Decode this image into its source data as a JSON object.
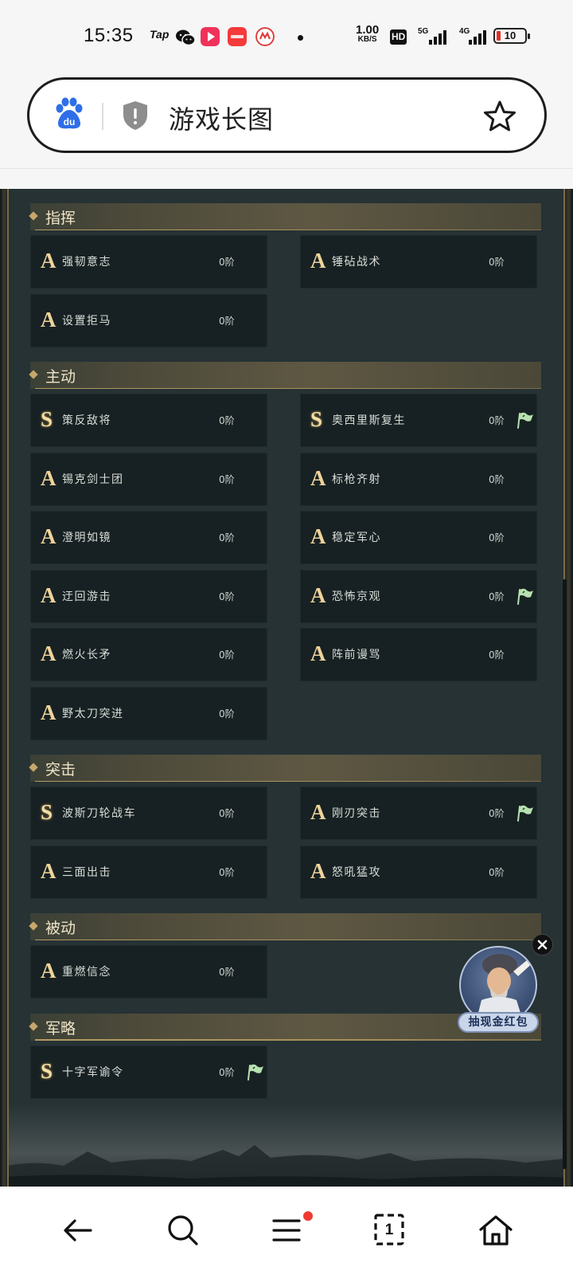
{
  "status_bar": {
    "time": "15:35",
    "tap_label": "Tap",
    "speed_value": "1.00",
    "speed_unit": "KB/S",
    "hd_label": "HD",
    "network_1": "5G",
    "network_2": "4G",
    "battery": "10",
    "battery_color": "#e0302a"
  },
  "browser": {
    "title": "游戏长图",
    "open_tabs": "1"
  },
  "sections": [
    {
      "title": "指挥",
      "skills": [
        {
          "grade": "A",
          "name": "强韧意志",
          "level": "0阶",
          "flag": false
        },
        {
          "grade": "A",
          "name": "锤砧战术",
          "level": "0阶",
          "flag": false
        },
        {
          "grade": "A",
          "name": "设置拒马",
          "level": "0阶",
          "flag": false
        }
      ]
    },
    {
      "title": "主动",
      "skills": [
        {
          "grade": "S",
          "name": "策反敌将",
          "level": "0阶",
          "flag": false
        },
        {
          "grade": "S",
          "name": "奥西里斯复生",
          "level": "0阶",
          "flag": true
        },
        {
          "grade": "A",
          "name": "锡克剑士团",
          "level": "0阶",
          "flag": false
        },
        {
          "grade": "A",
          "name": "标枪齐射",
          "level": "0阶",
          "flag": false
        },
        {
          "grade": "A",
          "name": "澄明如镜",
          "level": "0阶",
          "flag": false
        },
        {
          "grade": "A",
          "name": "稳定军心",
          "level": "0阶",
          "flag": false
        },
        {
          "grade": "A",
          "name": "迂回游击",
          "level": "0阶",
          "flag": false
        },
        {
          "grade": "A",
          "name": "恐怖京观",
          "level": "0阶",
          "flag": true
        },
        {
          "grade": "A",
          "name": "燃火长矛",
          "level": "0阶",
          "flag": false
        },
        {
          "grade": "A",
          "name": "阵前谩骂",
          "level": "0阶",
          "flag": false
        },
        {
          "grade": "A",
          "name": "野太刀突进",
          "level": "0阶",
          "flag": false
        }
      ]
    },
    {
      "title": "突击",
      "skills": [
        {
          "grade": "S",
          "name": "波斯刀轮战车",
          "level": "0阶",
          "flag": false
        },
        {
          "grade": "A",
          "name": "刚刃突击",
          "level": "0阶",
          "flag": true
        },
        {
          "grade": "A",
          "name": "三面出击",
          "level": "0阶",
          "flag": false
        },
        {
          "grade": "A",
          "name": "怒吼猛攻",
          "level": "0阶",
          "flag": false
        }
      ]
    },
    {
      "title": "被动",
      "skills": [
        {
          "grade": "A",
          "name": "重燃信念",
          "level": "0阶",
          "flag": false
        }
      ]
    },
    {
      "title": "军略",
      "skills": [
        {
          "grade": "S",
          "name": "十字军谕令",
          "level": "0阶",
          "flag": true
        }
      ]
    }
  ],
  "promo": {
    "label": "抽现金红包"
  },
  "colors": {
    "content_bg": "#263234",
    "card_bg": "#172123",
    "grade_gold": "#efd39a",
    "flag_green": "#b7e2b0"
  }
}
